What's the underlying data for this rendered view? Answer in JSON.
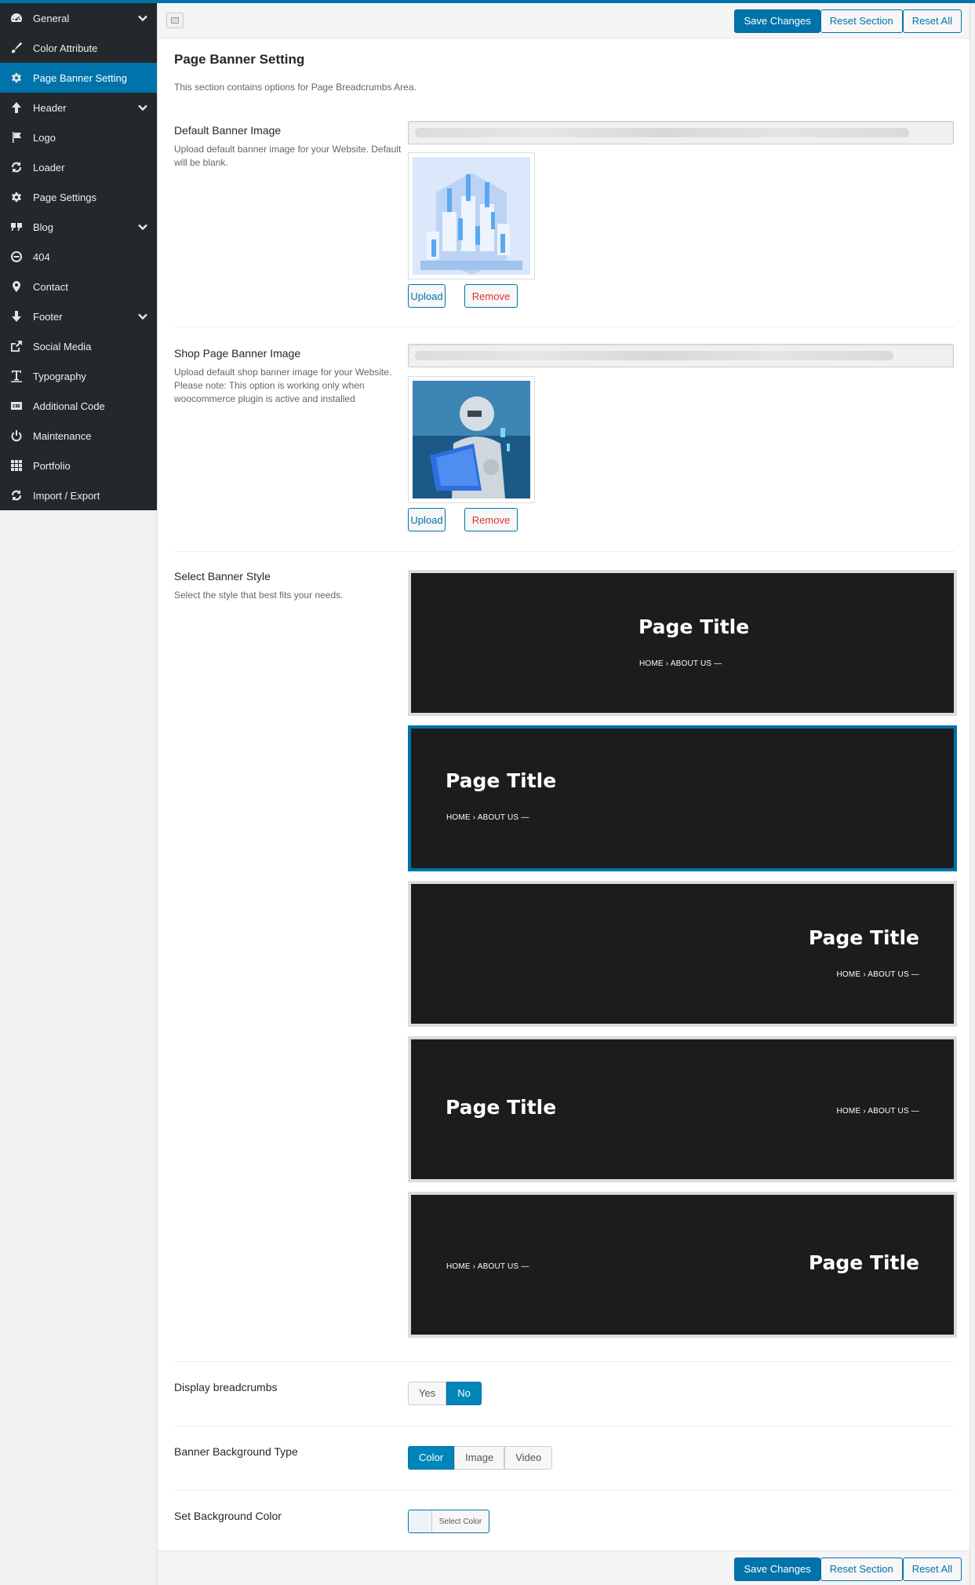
{
  "sidebar": {
    "items": [
      {
        "label": "General",
        "icon": "dashboard-icon",
        "has_children": true
      },
      {
        "label": "Color Attribute",
        "icon": "brush-icon",
        "has_children": false
      },
      {
        "label": "Page Banner Setting",
        "icon": "gear-icon",
        "has_children": false,
        "active": true
      },
      {
        "label": "Header",
        "icon": "arrow-up-icon",
        "has_children": true
      },
      {
        "label": "Logo",
        "icon": "flag-icon",
        "has_children": false
      },
      {
        "label": "Loader",
        "icon": "refresh-icon",
        "has_children": false
      },
      {
        "label": "Page Settings",
        "icon": "gear-icon",
        "has_children": false
      },
      {
        "label": "Blog",
        "icon": "quote-icon",
        "has_children": true
      },
      {
        "label": "404",
        "icon": "minus-circle-icon",
        "has_children": false
      },
      {
        "label": "Contact",
        "icon": "map-pin-icon",
        "has_children": false
      },
      {
        "label": "Footer",
        "icon": "arrow-down-icon",
        "has_children": true
      },
      {
        "label": "Social Media",
        "icon": "share-icon",
        "has_children": false
      },
      {
        "label": "Typography",
        "icon": "text-icon",
        "has_children": false
      },
      {
        "label": "Additional Code",
        "icon": "css-icon",
        "has_children": false
      },
      {
        "label": "Maintenance",
        "icon": "power-icon",
        "has_children": false
      },
      {
        "label": "Portfolio",
        "icon": "grid-icon",
        "has_children": false
      },
      {
        "label": "Import / Export",
        "icon": "refresh-icon",
        "has_children": false
      }
    ]
  },
  "toolbar": {
    "save_label": "Save Changes",
    "reset_section_label": "Reset Section",
    "reset_all_label": "Reset All"
  },
  "section": {
    "title": "Page Banner Setting",
    "description": "This section contains options for Page Breadcrumbs Area."
  },
  "fields": {
    "default_banner": {
      "label": "Default Banner Image",
      "description": "Upload default banner image for your Website. Default will be blank.",
      "upload_label": "Upload",
      "remove_label": "Remove"
    },
    "shop_banner": {
      "label": "Shop Page Banner Image",
      "description": "Upload default shop banner image for your Website. Please note: This option is working only when woocommerce plugin is active and installed",
      "upload_label": "Upload",
      "remove_label": "Remove"
    },
    "banner_style": {
      "label": "Select Banner Style",
      "description": "Select the style that best fits your needs.",
      "page_title": "Page Title",
      "crumb_home": "HOME",
      "crumb_separator": "›",
      "crumb_about": "ABOUT US —",
      "selected_index": 1
    },
    "display_breadcrumbs": {
      "label": "Display breadcrumbs",
      "options": [
        "Yes",
        "No"
      ],
      "selected": "No"
    },
    "background_type": {
      "label": "Banner Background Type",
      "options": [
        "Color",
        "Image",
        "Video"
      ],
      "selected": "Color"
    },
    "background_color": {
      "label": "Set Background Color",
      "button_label": "Select Color"
    }
  },
  "colors": {
    "accent": "#0073aa",
    "sidebar_bg": "#23282d",
    "banner_bg": "#1c1c1c",
    "remove": "#dc3232"
  }
}
